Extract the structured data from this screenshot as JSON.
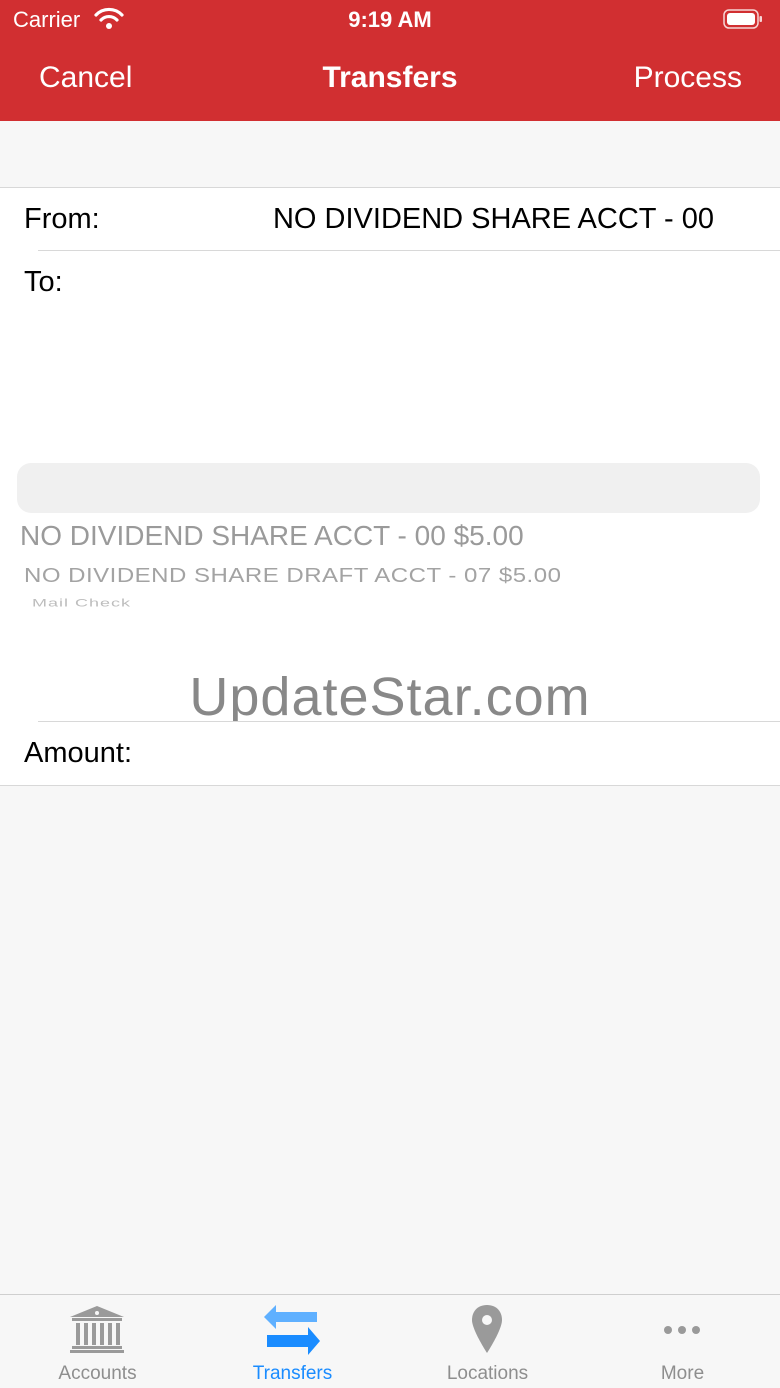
{
  "status_bar": {
    "carrier": "Carrier",
    "time": "9:19 AM"
  },
  "nav": {
    "cancel": "Cancel",
    "title": "Transfers",
    "process": "Process"
  },
  "form": {
    "from_label": "From:",
    "from_value": "NO DIVIDEND SHARE ACCT - 00",
    "to_label": "To:",
    "amount_label": "Amount:"
  },
  "picker": {
    "options": [
      "NO DIVIDEND SHARE ACCT - 00  $5.00",
      "NO DIVIDEND SHARE DRAFT ACCT - 07  $5.00",
      "Mail Check"
    ]
  },
  "watermark": "UpdateStar.com",
  "tabs": [
    {
      "label": "Accounts",
      "icon": "bank-icon",
      "active": false
    },
    {
      "label": "Transfers",
      "icon": "transfer-arrows-icon",
      "active": true
    },
    {
      "label": "Locations",
      "icon": "map-pin-icon",
      "active": false
    },
    {
      "label": "More",
      "icon": "more-dots-icon",
      "active": false
    }
  ],
  "colors": {
    "header": "#d12f31",
    "active_tab": "#1a8cff",
    "inactive_tab": "#8e8e8e"
  }
}
